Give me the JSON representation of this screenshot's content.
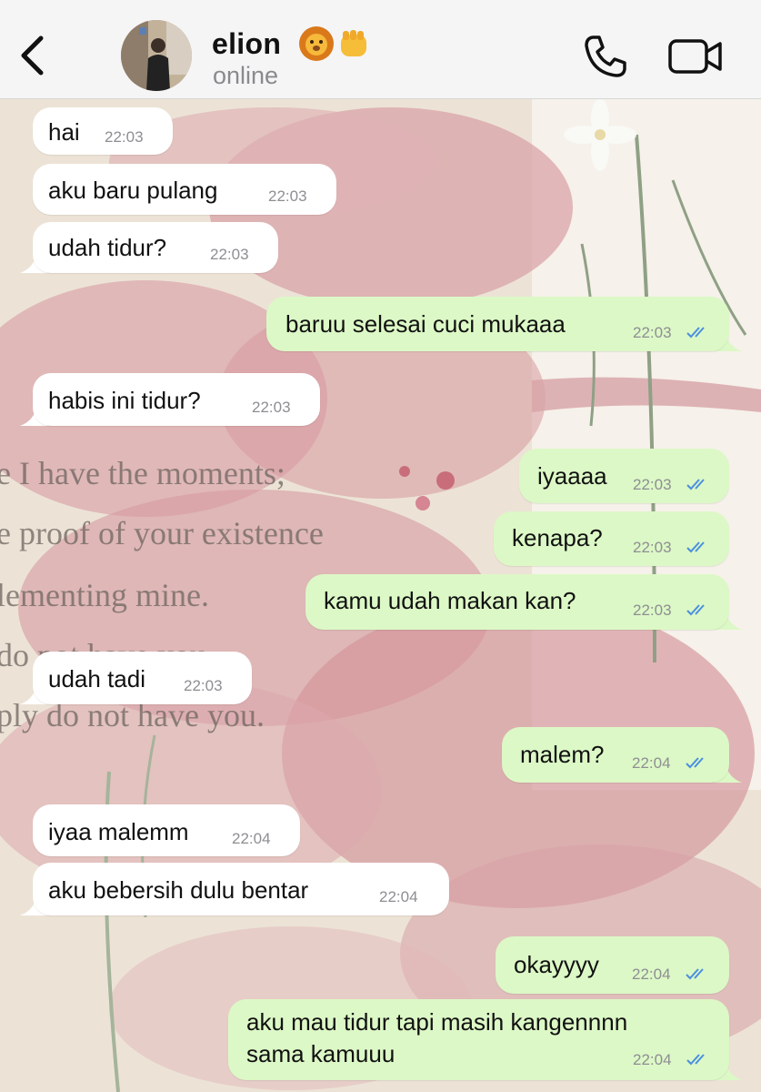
{
  "header": {
    "back_icon": "chevron-left-icon",
    "contact_name": "elion",
    "emojis": [
      "lion-emoji",
      "fist-emoji"
    ],
    "status": "online",
    "call_icon": "phone-icon",
    "video_icon": "video-camera-icon"
  },
  "wallpaper_text": [
    "e I have the moments;",
    "e proof of your existence",
    "lementing mine.",
    "do not have you.",
    "ply do not have you."
  ],
  "messages": [
    {
      "dir": "in",
      "text": "hai",
      "time": "22:03"
    },
    {
      "dir": "in",
      "text": "aku baru pulang",
      "time": "22:03"
    },
    {
      "dir": "in",
      "text": "udah tidur?",
      "time": "22:03"
    },
    {
      "dir": "out",
      "text": "baruu selesai cuci mukaaa",
      "time": "22:03"
    },
    {
      "dir": "in",
      "text": "habis ini tidur?",
      "time": "22:03"
    },
    {
      "dir": "out",
      "text": "iyaaaa",
      "time": "22:03"
    },
    {
      "dir": "out",
      "text": "kenapa?",
      "time": "22:03"
    },
    {
      "dir": "out",
      "text": "kamu udah makan kan?",
      "time": "22:03"
    },
    {
      "dir": "in",
      "text": "udah tadi",
      "time": "22:03"
    },
    {
      "dir": "out",
      "text": "malem?",
      "time": "22:04"
    },
    {
      "dir": "in",
      "text": "iyaa malemm",
      "time": "22:04"
    },
    {
      "dir": "in",
      "text": "aku bebersih dulu bentar",
      "time": "22:04"
    },
    {
      "dir": "out",
      "text": "okayyyy",
      "time": "22:04"
    },
    {
      "dir": "out",
      "text": "aku mau tidur tapi masih kangennnn",
      "text2": "sama kamuuu",
      "time": "22:04"
    }
  ],
  "colors": {
    "incoming_bubble": "#ffffff",
    "outgoing_bubble": "#dcf8c6",
    "read_ticks": "#4a8fe0",
    "header_bg": "#f5f5f6",
    "status_text": "#8a8a8e"
  }
}
